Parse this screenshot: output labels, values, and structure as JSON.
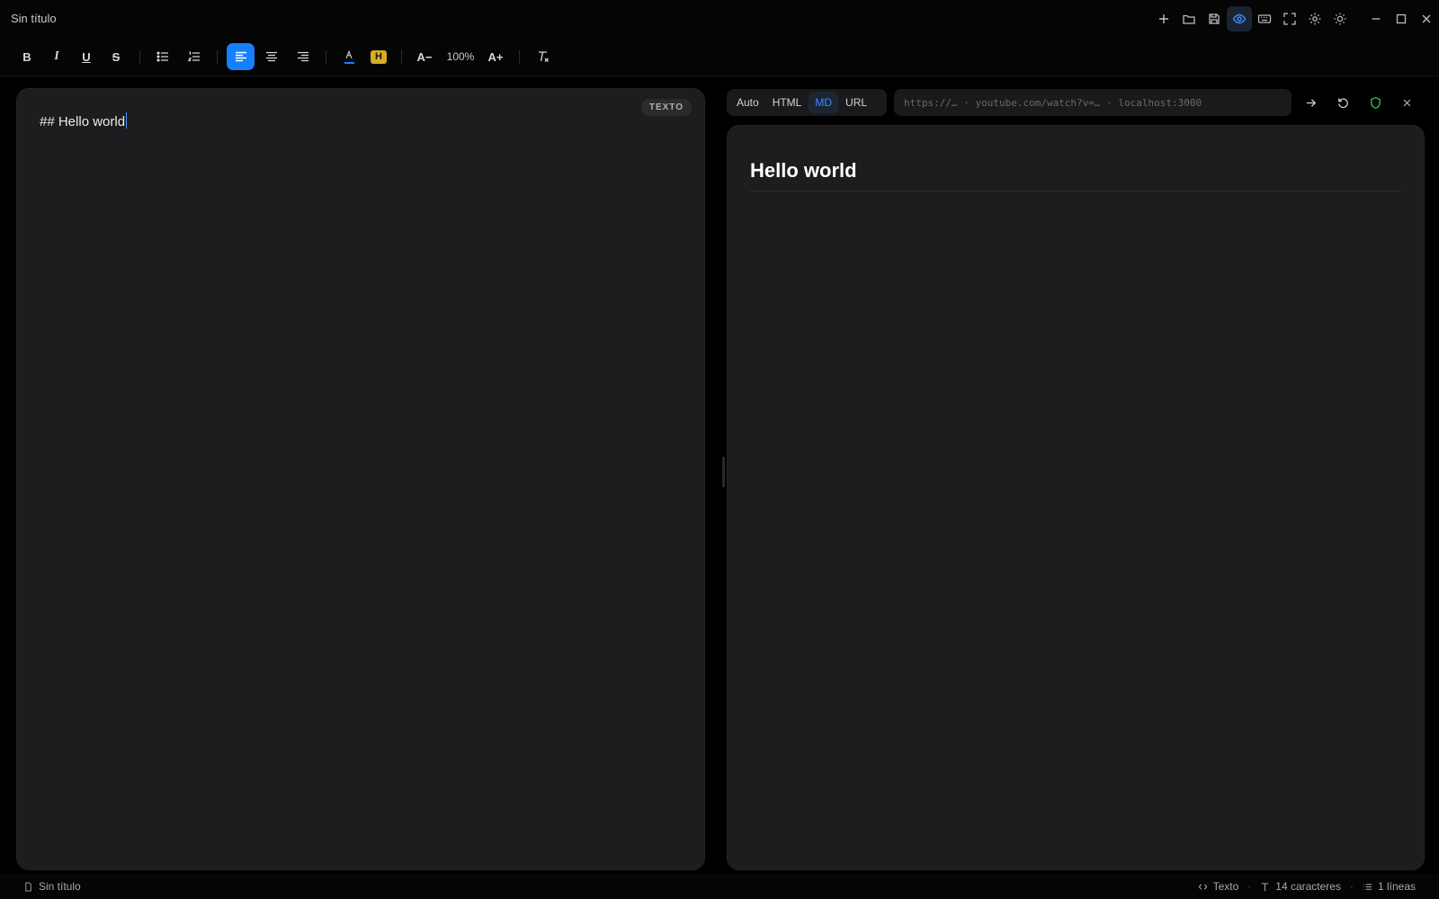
{
  "window": {
    "title": "Sin título"
  },
  "toolbar": {
    "bold": "B",
    "italic": "I",
    "underline": "U",
    "strike": "S",
    "highlight": "H",
    "font_decrease": "A−",
    "zoom": "100%",
    "font_increase": "A+",
    "text_color_accent": "#1580ff",
    "highlight_color": "#d7ad24"
  },
  "editor": {
    "badge": "TEXTO",
    "content": "## Hello world"
  },
  "preview": {
    "modes": [
      "Auto",
      "HTML",
      "MD",
      "URL"
    ],
    "active_mode": "MD",
    "url_placeholder": "https://…  ·  youtube.com/watch?v=…  ·  localhost:3000",
    "heading": "Hello world"
  },
  "status": {
    "file": "Sin título",
    "mode": "Texto",
    "chars": "14 caracteres",
    "lines": "1 líneas"
  }
}
